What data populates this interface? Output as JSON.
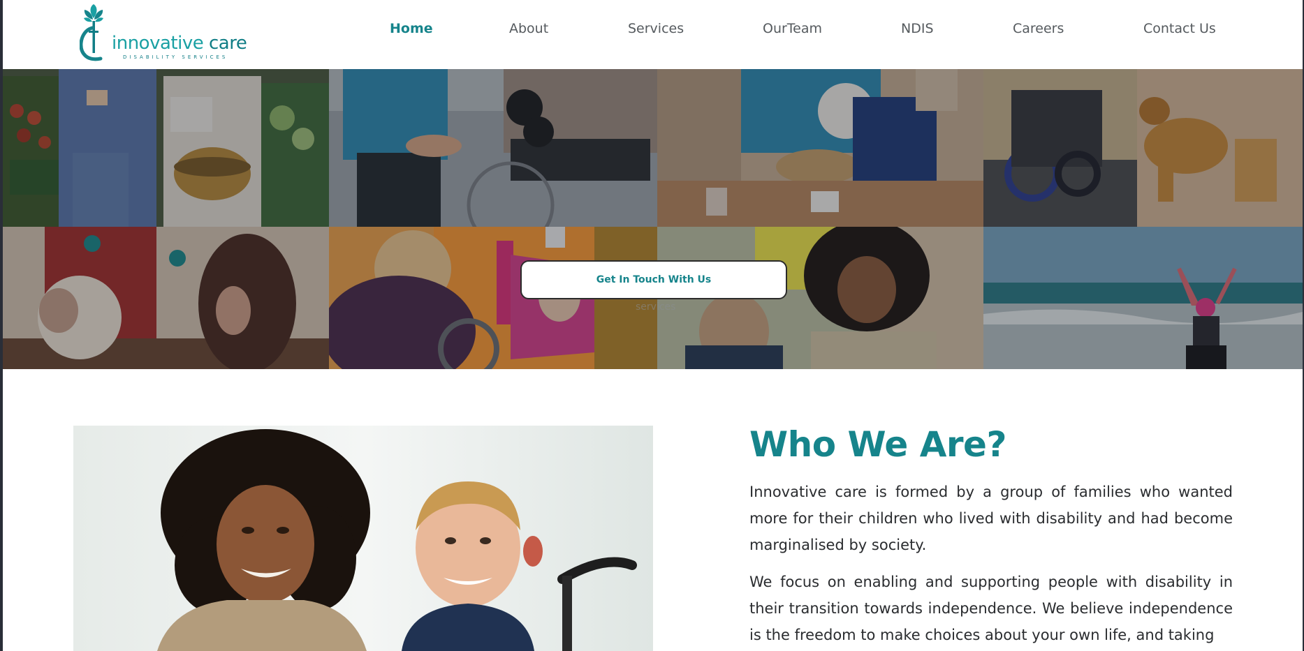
{
  "brand": {
    "name_part1": "innovative",
    "name_part2": "care",
    "tagline": "DISABILITY SERVICES",
    "colors": {
      "primary": "#16848b",
      "accent": "#1aa0a3"
    }
  },
  "nav": {
    "items": [
      {
        "label": "Home",
        "active": true
      },
      {
        "label": "About"
      },
      {
        "label": "Services"
      },
      {
        "label": "OurTeam"
      },
      {
        "label": "NDIS"
      },
      {
        "label": "Careers"
      },
      {
        "label": "Contact Us"
      }
    ]
  },
  "hero": {
    "cta_label": "Get In Touch With Us",
    "ghost_label": "services"
  },
  "who": {
    "title": "Who We Are?",
    "paragraphs": [
      "Innovative care is formed by a group of families who wanted more for their children who lived with disability and had become marginalised by society.",
      "We focus on enabling and supporting people with disability in their transition towards independence. We believe independence is the freedom to make choices about your own life, and taking"
    ]
  }
}
